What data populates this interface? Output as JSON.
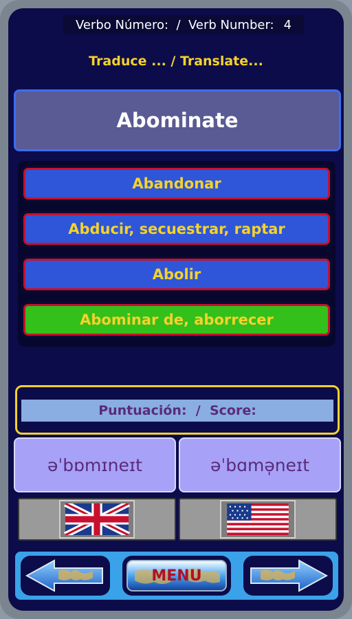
{
  "header": {
    "verb_label": "Verbo Número:  /  Verb Number:",
    "verb_number": "4"
  },
  "prompt": "Traduce ... /  Translate...",
  "word": "Abominate",
  "options": [
    {
      "label": "Abandonar",
      "state": "neutral"
    },
    {
      "label": "Abducir, secuestrar, raptar",
      "state": "neutral"
    },
    {
      "label": "Abolir",
      "state": "neutral"
    },
    {
      "label": "Abominar de, aborrecer",
      "state": "correct"
    }
  ],
  "score": {
    "label": "Puntuación:  /  Score:"
  },
  "pronunciation": {
    "uk": "əˈbɒmɪneɪt",
    "us": "əˈbɑmə̩neɪt"
  },
  "flags": {
    "uk": "uk-flag-icon",
    "us": "us-flag-icon"
  },
  "nav": {
    "menu_label": "MENU",
    "prev_icon": "arrow-left-icon",
    "next_icon": "arrow-right-icon"
  },
  "colors": {
    "background": "#0c0c4a",
    "accent_yellow": "#f5d22b",
    "option_blue": "#2f56d8",
    "option_correct": "#33c01a",
    "option_border": "#c8102e",
    "phonetic_bg": "#a7a2f8"
  }
}
